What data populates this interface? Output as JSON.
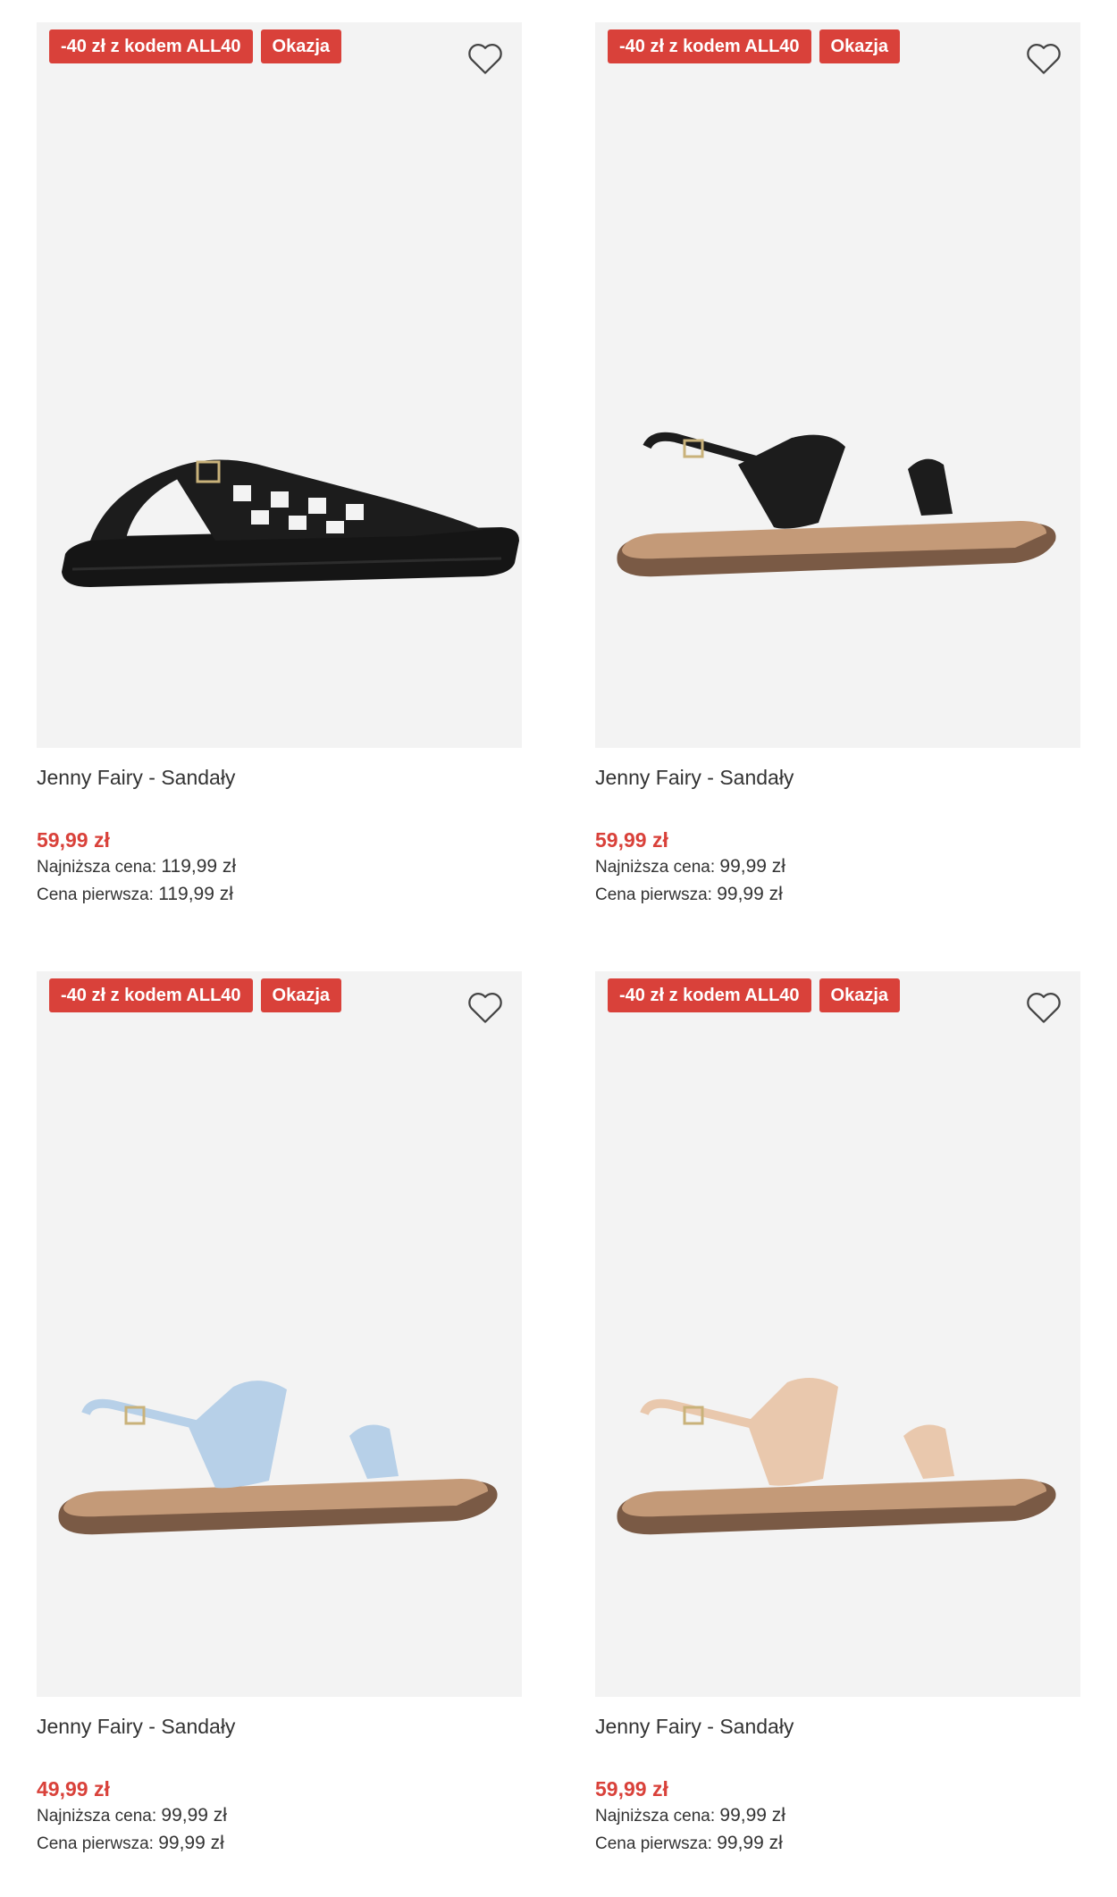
{
  "products": [
    {
      "promo_badge": "-40 zł z kodem ALL40",
      "deal_badge": "Okazja",
      "title": "Jenny Fairy - Sandały",
      "price": "59,99 zł",
      "lowest_label": "Najniższa cena:",
      "lowest_value": "119,99 zł",
      "original_label": "Cena pierwsza:",
      "original_value": "119,99 zł",
      "color": "#1c1c1c"
    },
    {
      "promo_badge": "-40 zł z kodem ALL40",
      "deal_badge": "Okazja",
      "title": "Jenny Fairy - Sandały",
      "price": "59,99 zł",
      "lowest_label": "Najniższa cena:",
      "lowest_value": "99,99 zł",
      "original_label": "Cena pierwsza:",
      "original_value": "99,99 zł",
      "color": "#1e1e1e"
    },
    {
      "promo_badge": "-40 zł z kodem ALL40",
      "deal_badge": "Okazja",
      "title": "Jenny Fairy - Sandały",
      "price": "49,99 zł",
      "lowest_label": "Najniższa cena:",
      "lowest_value": "99,99 zł",
      "original_label": "Cena pierwsza:",
      "original_value": "99,99 zł",
      "color": "#b7d0e8"
    },
    {
      "promo_badge": "-40 zł z kodem ALL40",
      "deal_badge": "Okazja",
      "title": "Jenny Fairy - Sandały",
      "price": "59,99 zł",
      "lowest_label": "Najniższa cena:",
      "lowest_value": "99,99 zł",
      "original_label": "Cena pierwsza:",
      "original_value": "99,99 zł",
      "color": "#e9c8ad"
    }
  ],
  "colors": {
    "accent": "#d9413a",
    "image_bg": "#f3f3f3"
  },
  "icons": {
    "wishlist": "heart-outline-icon"
  }
}
